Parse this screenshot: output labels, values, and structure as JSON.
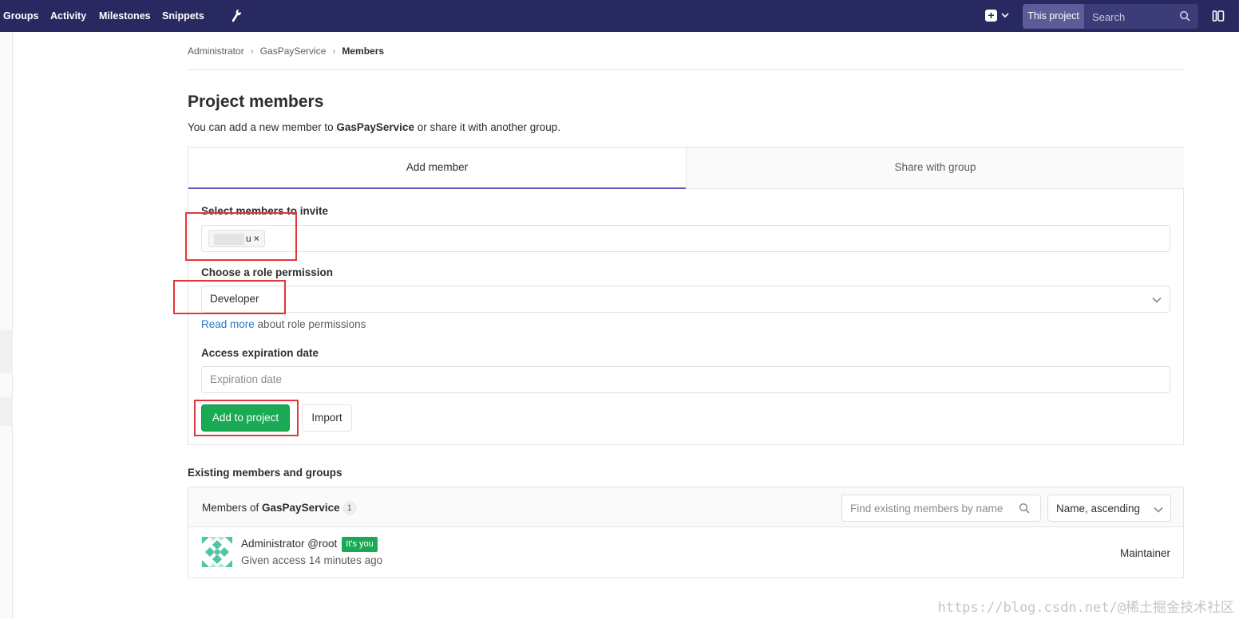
{
  "navbar": {
    "links": [
      "Groups",
      "Activity",
      "Milestones",
      "Snippets"
    ],
    "search_scope": "This project",
    "search_placeholder": "Search",
    "background": "#292961"
  },
  "breadcrumb": [
    "Administrator",
    "GasPayService",
    "Members"
  ],
  "page": {
    "title": "Project members",
    "intro_prefix": "You can add a new member to ",
    "project_name": "GasPayService",
    "intro_suffix": " or share it with another group."
  },
  "tabs": [
    {
      "label": "Add member",
      "active": true
    },
    {
      "label": "Share with group",
      "active": false
    }
  ],
  "form": {
    "invite_label": "Select members to invite",
    "selected_token": "u",
    "role_label": "Choose a role permission",
    "role_value": "Developer",
    "read_more": "Read more",
    "read_more_suffix": " about role permissions",
    "expiry_label": "Access expiration date",
    "expiry_placeholder": "Expiration date",
    "add_button": "Add to project",
    "import_button": "Import",
    "accent": "#1aaa55"
  },
  "existing": {
    "title": "Existing members and groups",
    "header_prefix": "Members of ",
    "project_name": "GasPayService",
    "count": "1",
    "find_placeholder": "Find existing members by name",
    "sort_value": "Name, ascending",
    "members": [
      {
        "name": "Administrator",
        "username": "@root",
        "badge": "It's you",
        "access": "Given access 14 minutes ago",
        "role": "Maintainer"
      }
    ]
  },
  "watermark": "https://blog.csdn.net/@稀土掘金技术社区",
  "highlight_color": "#e0383c"
}
